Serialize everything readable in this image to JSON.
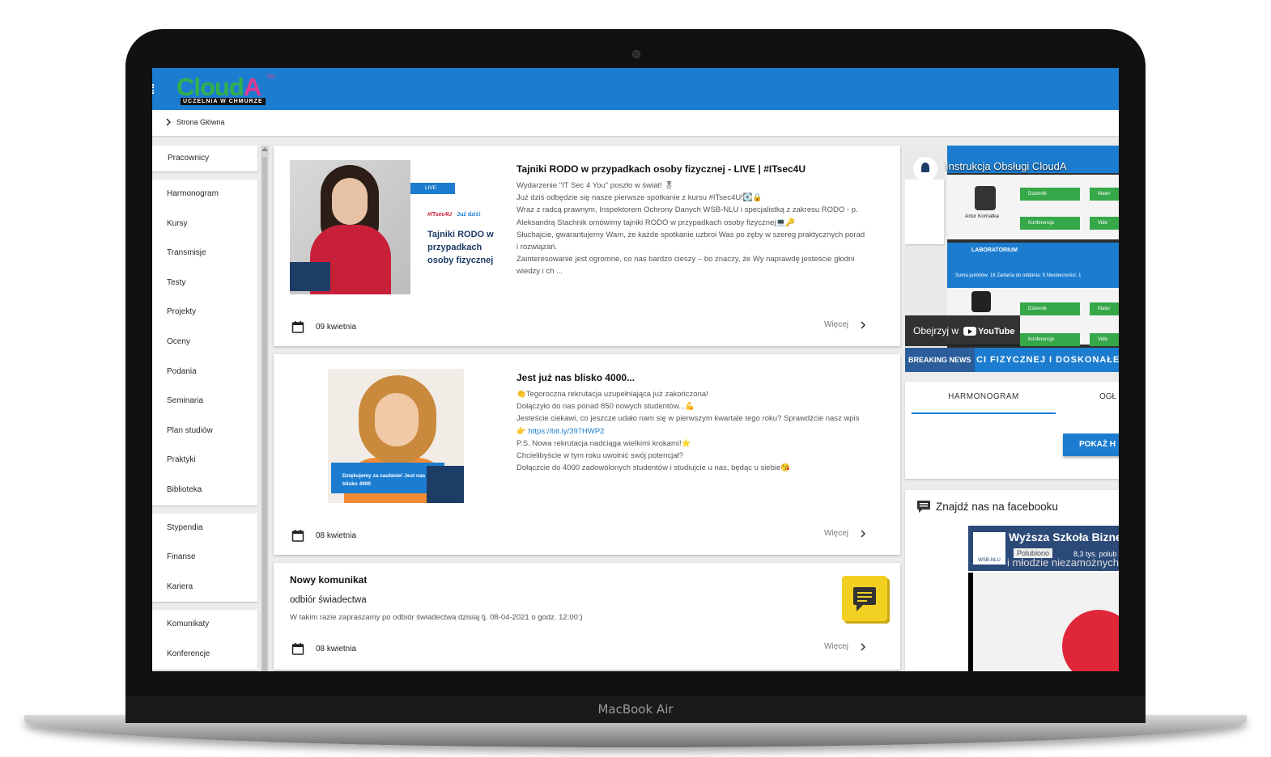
{
  "device": {
    "brand": "MacBook Air"
  },
  "app": {
    "logo_main": "Cloud",
    "logo_accent": "A",
    "logo_sub": "UCZELNIA W CHMURZE",
    "logo_tm": "TM"
  },
  "breadcrumb": {
    "label": "Strona Główna"
  },
  "sidebar": {
    "groups": [
      [
        "Pracownicy"
      ],
      [
        "Harmonogram",
        "Kursy",
        "Transmisje",
        "Testy",
        "Projekty",
        "Oceny",
        "Podania",
        "Seminaria",
        "Plan studiów",
        "Praktyki",
        "Biblioteka"
      ],
      [
        "Stypendia",
        "Finanse",
        "Kariera"
      ],
      [
        "Komunikaty",
        "Konferencje"
      ]
    ]
  },
  "posts": [
    {
      "title": "Tajniki RODO w przypadkach osoby fizycznej - LIVE | #ITsec4U",
      "lines": [
        "Wydarzenie \"IT Sec 4 You\" poszło w świat! 🎖",
        "Już dziś odbędzie się nasze pierwsze spotkanie z kursu #ITsec4U!💽🔒",
        "Wraz z radcą prawnym, Inspektorem Ochrony Danych WSB-NLU i specjalistką z zakresu RODO - p.",
        "Aleksandrą Stachnik omówimy tajniki RODO w przypadkach osoby fizycznej💻🔑",
        "Słuchajcie, gwarantujemy Wam, że każde spotkanie uzbroi Was po zęby w szereg praktycznych porad",
        "i rozwiązań.",
        "Zainteresowanie jest ogromne, co nas bardzo cieszy – bo znaczy, że Wy naprawdę jesteście głodni",
        "wiedzy i ch ..."
      ],
      "date": "09 kwietnia",
      "more": "Więcej",
      "image": {
        "live": "LIVE",
        "tag1": "#ITsec4U",
        "tag2": "Już dziś!",
        "headline": "Tajniki RODO w przypadkach osoby fizycznej"
      }
    },
    {
      "title": "Jest już nas blisko 4000...",
      "lines": [
        "👏Tegoroczna rekrutacja uzupełniająca już zakończona!",
        "Dołączyło do nas ponad 850 nowych studentów...💪",
        "Jesteście ciekawi, co jeszcze udało nam się w pierwszym kwartale tego roku? Sprawdźcie nasz wpis",
        "👉 https://bit.ly/397HWP2",
        "P.S. Nowa rekrutacja nadciąga wielkimi krokami!⭐",
        "Chcielibyście w tym roku uwolnić swój potencjał?",
        "Dołączcie do 4000 zadowolonych studentów i studiujcie u nas, będąc u siebie😘"
      ],
      "date": "08 kwietnia",
      "more": "Więcej",
      "image": {
        "panel": "Dziękujemy za zaufanie! Jest nas już blisko 4000"
      }
    }
  ],
  "notice": {
    "title": "Nowy komunikat",
    "subtitle": "odbiór świadectwa",
    "text": "W takim razie zapraszamy po odbiór świadectwa dzisiaj tj. 08-04-2021 o godz. 12:00:)",
    "date": "08 kwietnia",
    "more": "Więcej"
  },
  "video": {
    "title": "Instrukcja Obsługi CloudA",
    "watch_on": "Obejrzyj w",
    "youtube": "YouTube",
    "lab_label": "LABORATORIUM",
    "person": "Artur Kornatka",
    "stats": "Suma punktów: 16   Zadania do oddania: 5   Nieobecności: 1",
    "buttons": [
      "Dziennik",
      "Konferencje",
      "Dziennik",
      "Konferencje"
    ],
    "buttons_cut": [
      "Mater",
      "Vide",
      "Mater",
      "Vide"
    ]
  },
  "news_ticker": {
    "tag": "BREAKING NEWS",
    "text": "CI FIZYCZNEJ I DOSKONAŁEJ"
  },
  "tabs": {
    "items": [
      "HARMONOGRAM",
      "OGŁ"
    ],
    "button": "POKAŻ H"
  },
  "facebook": {
    "heading": "Znajdź nas na facebooku",
    "page_name": "Wyższa Szkoła Bizne",
    "like": "Polubiono",
    "count": "8,3 tys. polub",
    "subline": "i młodzie niezamożnych rodzin",
    "logo": "WSB-NLU"
  }
}
